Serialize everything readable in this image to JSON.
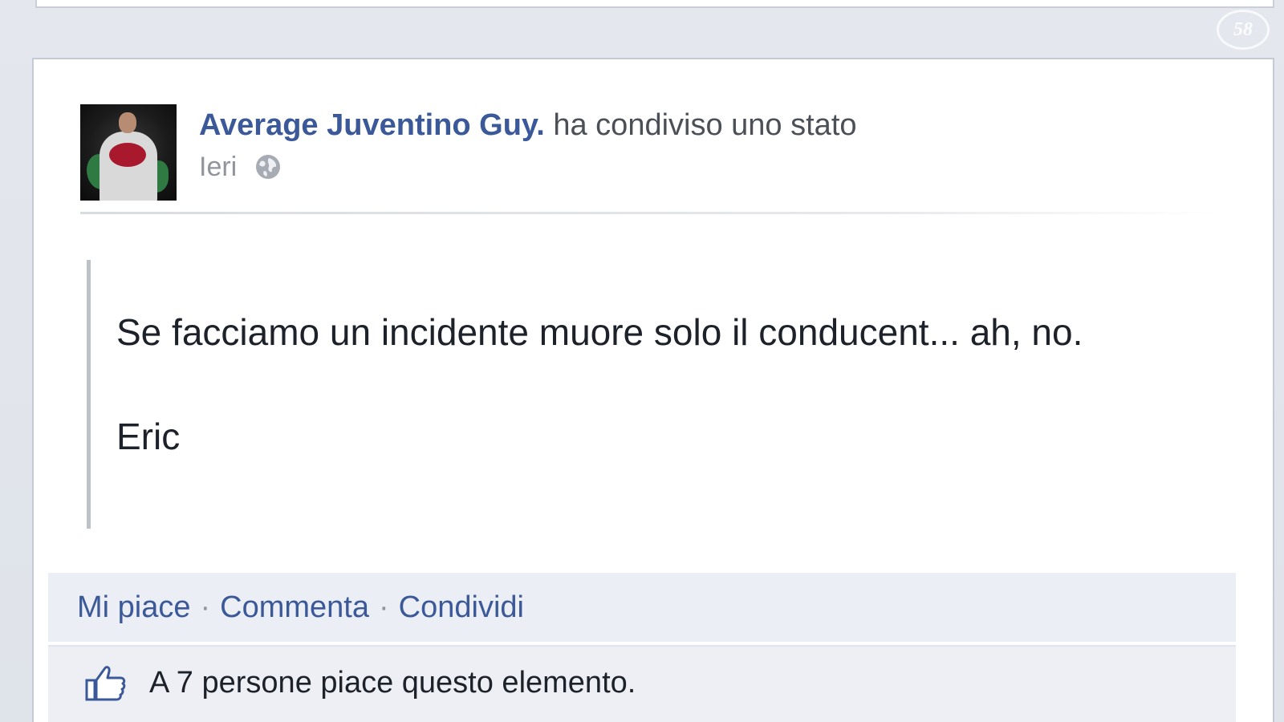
{
  "post": {
    "author": "Average Juventino Guy.",
    "action": "ha condiviso uno stato",
    "timestamp": "Ieri",
    "privacy_icon": "globe-icon",
    "status_text": "Se facciamo un incidente muore solo il conducent... ah, no.",
    "signature": "Eric"
  },
  "actions": {
    "like": "Mi piace",
    "comment": "Commenta",
    "share": "Condividi",
    "separator": "·"
  },
  "likes": {
    "icon": "thumbs-up-icon",
    "text": "A 7 persone piace questo elemento."
  },
  "watermark": {
    "text": "58"
  },
  "colors": {
    "author": "#3b5998",
    "link": "#3b5998",
    "muted": "#90949c",
    "bar_bg": "#eceef5"
  }
}
